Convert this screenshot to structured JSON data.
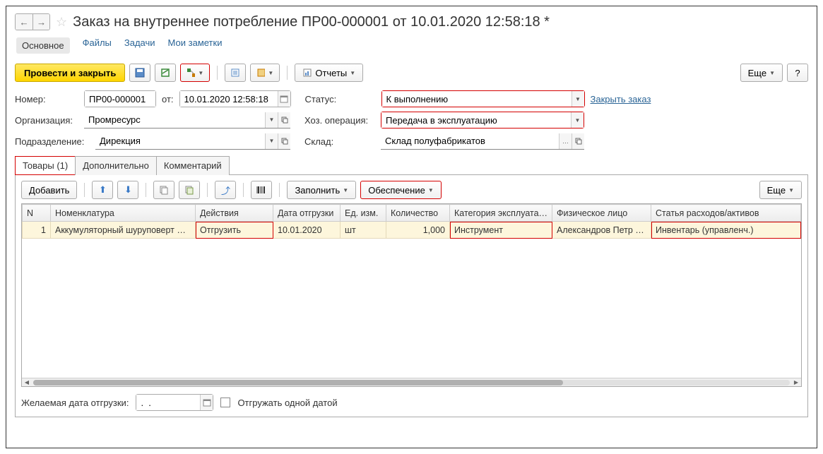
{
  "title": "Заказ на внутреннее потребление ПР00-000001 от 10.01.2020 12:58:18 *",
  "nav": {
    "main": "Основное",
    "files": "Файлы",
    "tasks": "Задачи",
    "notes": "Мои заметки"
  },
  "toolbar": {
    "post_close": "Провести и закрыть",
    "reports": "Отчеты",
    "more": "Еще",
    "help": "?"
  },
  "form": {
    "number_label": "Номер:",
    "number_value": "ПР00-000001",
    "from_label": "от:",
    "date_value": "10.01.2020 12:58:18",
    "status_label": "Статус:",
    "status_value": "К выполнению",
    "close_order": "Закрыть заказ",
    "org_label": "Организация:",
    "org_value": "Промресурс",
    "operation_label": "Хоз. операция:",
    "operation_value": "Передача в эксплуатацию",
    "division_label": "Подразделение:",
    "division_value": "Дирекция",
    "warehouse_label": "Склад:",
    "warehouse_value": "Склад полуфабрикатов"
  },
  "tabs": {
    "goods": "Товары (1)",
    "additional": "Дополнительно",
    "comment": "Комментарий"
  },
  "tab_toolbar": {
    "add": "Добавить",
    "fill": "Заполнить",
    "supply": "Обеспечение",
    "more": "Еще"
  },
  "table": {
    "headers": {
      "n": "N",
      "nomenclature": "Номенклатура",
      "actions": "Действия",
      "ship_date": "Дата отгрузки",
      "unit": "Ед. изм.",
      "qty": "Количество",
      "category": "Категория эксплуата…",
      "person": "Физическое лицо",
      "article": "Статья расходов/активов"
    },
    "rows": [
      {
        "n": "1",
        "nomenclature": "Аккумуляторный шуруповерт …",
        "actions": "Отгрузить",
        "ship_date": "10.01.2020",
        "unit": "шт",
        "qty": "1,000",
        "category": "Инструмент",
        "person": "Александров Петр …",
        "article": "Инвентарь (управленч.)"
      }
    ]
  },
  "footer": {
    "ship_date_label": "Желаемая дата отгрузки:",
    "ship_date_value": ".  .",
    "single_date": "Отгружать одной датой"
  }
}
